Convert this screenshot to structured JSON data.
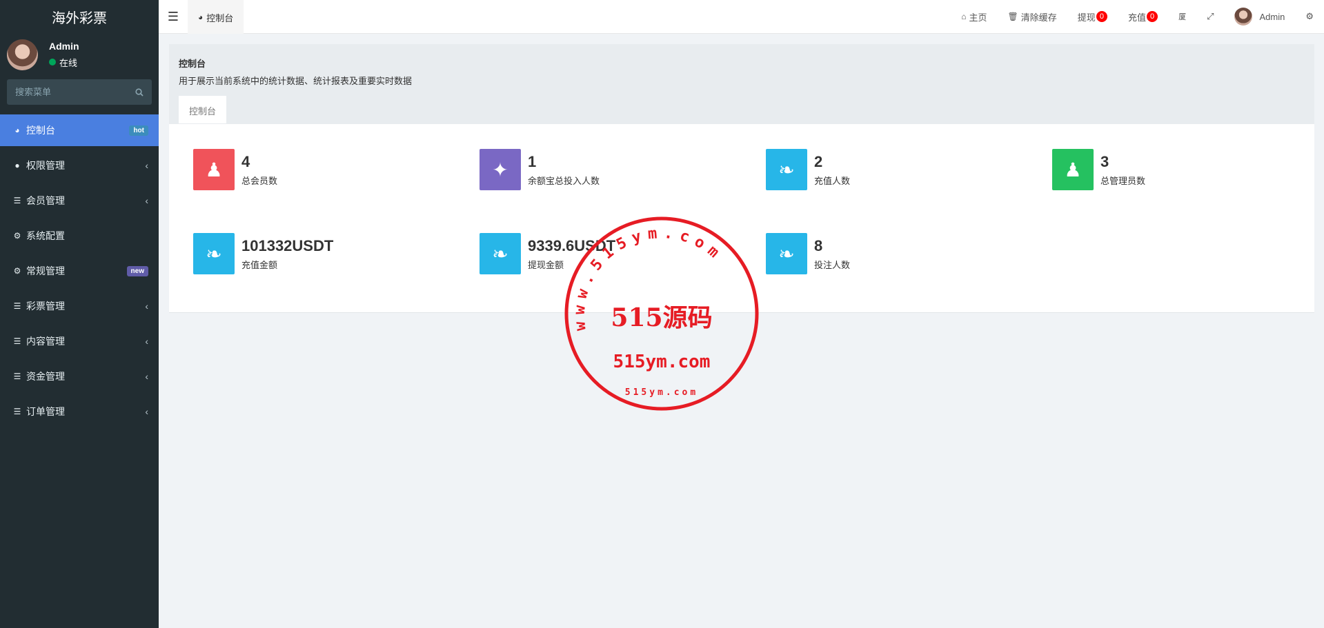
{
  "brand": "海外彩票",
  "user": {
    "name": "Admin",
    "status": "在线"
  },
  "search": {
    "placeholder": "搜索菜单"
  },
  "menu": [
    {
      "label": "控制台",
      "icon": "dashboard-icon",
      "badge": "hot",
      "active": true
    },
    {
      "label": "权限管理",
      "icon": "users-icon",
      "chevron": true
    },
    {
      "label": "会员管理",
      "icon": "list-icon",
      "chevron": true
    },
    {
      "label": "系统配置",
      "icon": "gear-icon"
    },
    {
      "label": "常规管理",
      "icon": "cogs-icon",
      "badge": "new"
    },
    {
      "label": "彩票管理",
      "icon": "list-icon",
      "chevron": true
    },
    {
      "label": "内容管理",
      "icon": "list-icon",
      "chevron": true
    },
    {
      "label": "资金管理",
      "icon": "list-icon",
      "chevron": true
    },
    {
      "label": "订单管理",
      "icon": "list-icon",
      "chevron": true
    }
  ],
  "header": {
    "tab_label": "控制台",
    "home": "主页",
    "clear_cache": "清除缓存",
    "withdraw": "提现",
    "withdraw_count": "0",
    "recharge": "充值",
    "recharge_count": "0",
    "admin_name": "Admin"
  },
  "panel": {
    "title": "控制台",
    "description": "用于展示当前系统中的统计数据、统计报表及重要实时数据",
    "tab": "控制台"
  },
  "stats": [
    {
      "value": "4",
      "label": "总会员数",
      "icon": "users-icon",
      "color": "#f0535a"
    },
    {
      "value": "1",
      "label": "余额宝总投入人数",
      "icon": "magic-wand-icon",
      "color": "#7a68c4"
    },
    {
      "value": "2",
      "label": "充值人数",
      "icon": "leaf-icon",
      "color": "#27b6e8"
    },
    {
      "value": "3",
      "label": "总管理员数",
      "icon": "user-icon",
      "color": "#25c160"
    },
    {
      "value": "101332USDT",
      "label": "充值金额",
      "icon": "leaf-icon",
      "color": "#27b6e8"
    },
    {
      "value": "9339.6USDT",
      "label": "提现金额",
      "icon": "leaf-icon",
      "color": "#27b6e8"
    },
    {
      "value": "8",
      "label": "投注人数",
      "icon": "leaf-icon",
      "color": "#27b6e8"
    }
  ],
  "watermark": {
    "ring_text": "www.515ym.com",
    "main": "515源码",
    "sub": "515ym.com",
    "bottom": "515ym.com"
  }
}
